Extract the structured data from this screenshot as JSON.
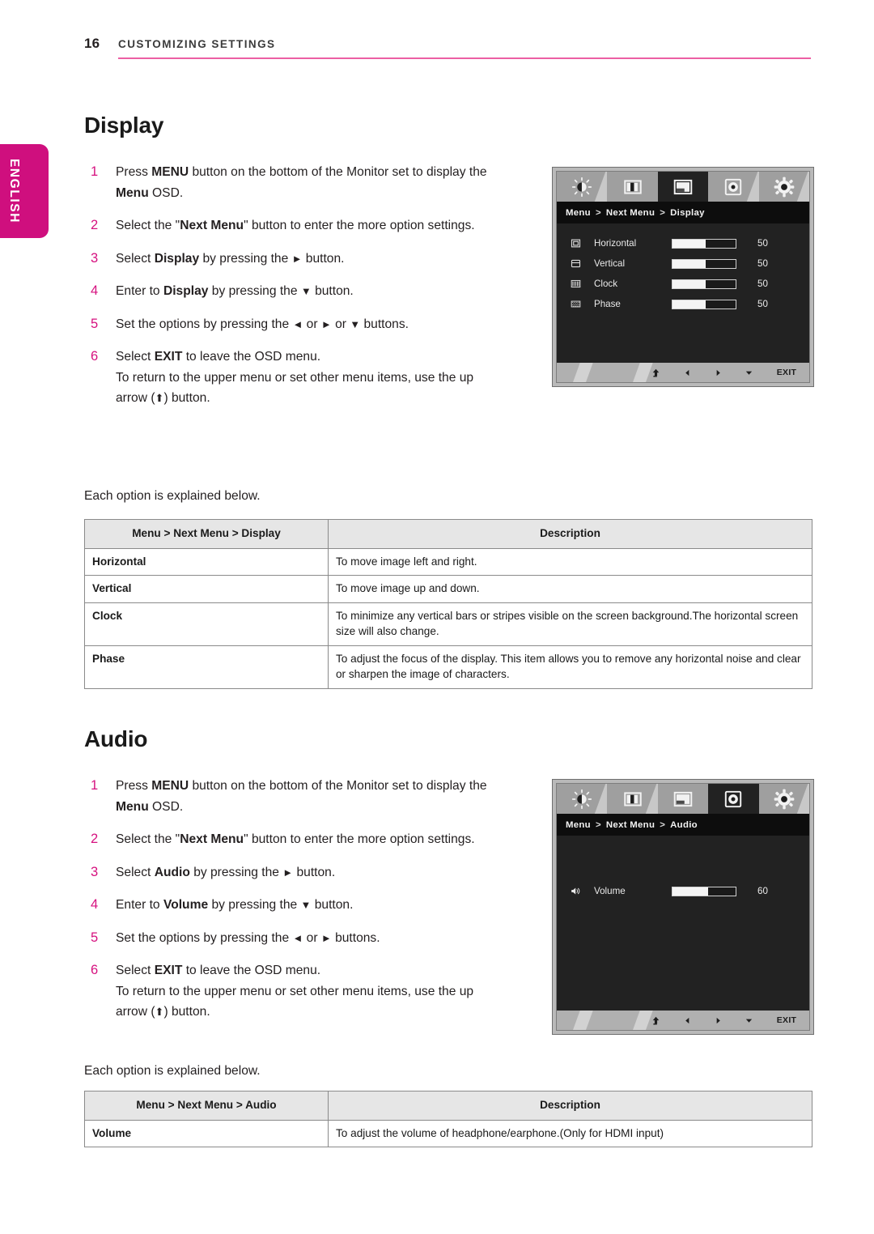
{
  "header": {
    "page_number": "16",
    "chapter": "CUSTOMIZING SETTINGS",
    "rule_color": "#ec5fa4"
  },
  "language_tab": {
    "label": "ENGLISH",
    "color": "#cf0f7e"
  },
  "sections": [
    {
      "title": "Display",
      "steps": [
        {
          "num": "1",
          "html": "Press <b>MENU</b> button on the bottom of the Monitor set to display the <b>Menu</b> OSD."
        },
        {
          "num": "2",
          "html": "Select the \"<b>Next Menu</b>\" button to enter the more option settings."
        },
        {
          "num": "3",
          "html": "Select <b>Display</b> by pressing the <span class=\"glyph\">&#9658;</span> button."
        },
        {
          "num": "4",
          "html": "Enter to <b>Display</b> by pressing the <span class=\"glyph\">&#9660;</span> button."
        },
        {
          "num": "5",
          "html": "Set the options by pressing the <span class=\"glyph\">&#9668;</span> or <span class=\"glyph\">&#9658;</span> or <span class=\"glyph\">&#9660;</span> buttons."
        },
        {
          "num": "6",
          "html": "Select <b>EXIT</b> to leave the OSD menu.<br>To return to the upper menu or set other menu items, use the up arrow (<span class=\"glyph\">&#11014;</span>) button."
        }
      ],
      "explain": "Each option is explained below.",
      "table": {
        "col1_header": "Menu > Next Menu > Display",
        "col2_header": "Description",
        "rows": [
          {
            "key": "Horizontal",
            "desc": "To move image left and right."
          },
          {
            "key": "Vertical",
            "desc": "To move image up and down."
          },
          {
            "key": "Clock",
            "desc": "To minimize any vertical bars or stripes visible on the screen background.The horizontal screen size will also change."
          },
          {
            "key": "Phase",
            "desc": "To adjust the focus of the display. This item allows you to remove any horizontal noise and clear or sharpen the image of characters."
          }
        ]
      },
      "osd": {
        "selected_tab_index": 2,
        "tabs": [
          "brightness-icon",
          "contrast-icon",
          "display-icon",
          "audio-disc-icon",
          "settings-gear-icon"
        ],
        "breadcrumb": [
          "Menu",
          "Next Menu",
          "Display"
        ],
        "separator": ">",
        "rows": [
          {
            "icon": "horizontal-position-icon",
            "label": "Horizontal",
            "value": "50",
            "fill_percent": 52
          },
          {
            "icon": "vertical-position-icon",
            "label": "Vertical",
            "value": "50",
            "fill_percent": 52
          },
          {
            "icon": "clock-pattern-icon",
            "label": "Clock",
            "value": "50",
            "fill_percent": 52
          },
          {
            "icon": "phase-pattern-icon",
            "label": "Phase",
            "value": "50",
            "fill_percent": 52
          }
        ],
        "footer": {
          "up": "up-arrow-icon",
          "left": "left-arrow-icon",
          "right": "right-arrow-icon",
          "down": "down-arrow-icon",
          "exit_label": "EXIT"
        }
      }
    },
    {
      "title": "Audio",
      "steps": [
        {
          "num": "1",
          "html": "Press <b>MENU</b> button on the bottom of the Monitor set to display the <b>Menu</b> OSD."
        },
        {
          "num": "2",
          "html": "Select the \"<b>Next Menu</b>\" button to enter the more option settings."
        },
        {
          "num": "3",
          "html": "Select <b>Audio</b> by pressing the <span class=\"glyph\">&#9658;</span> button."
        },
        {
          "num": "4",
          "html": "Enter to <b>Volume</b> by pressing the <span class=\"glyph\">&#9660;</span> button."
        },
        {
          "num": "5",
          "html": "Set the options by pressing the <span class=\"glyph\">&#9668;</span> or <span class=\"glyph\">&#9658;</span> buttons."
        },
        {
          "num": "6",
          "html": "Select <b>EXIT</b> to leave the OSD menu.<br>To return to the upper menu or set other menu items, use the up arrow (<span class=\"glyph\">&#11014;</span>) button."
        }
      ],
      "explain": "Each option is explained below.",
      "table": {
        "col1_header": "Menu > Next Menu > Audio",
        "col2_header": "Description",
        "rows": [
          {
            "key": "Volume",
            "desc": "To adjust the volume of headphone/earphone.(Only for HDMI input)"
          }
        ]
      },
      "osd": {
        "selected_tab_index": 3,
        "tabs": [
          "brightness-icon",
          "contrast-icon",
          "display-icon",
          "audio-disc-icon",
          "settings-gear-icon"
        ],
        "breadcrumb": [
          "Menu",
          "Next Menu",
          "Audio"
        ],
        "separator": ">",
        "rows": [
          {
            "icon": "speaker-icon",
            "label": "Volume",
            "value": "60",
            "fill_percent": 56
          }
        ],
        "footer": {
          "up": "up-arrow-icon",
          "left": "left-arrow-icon",
          "right": "right-arrow-icon",
          "down": "down-arrow-icon",
          "exit_label": "EXIT"
        }
      }
    }
  ]
}
